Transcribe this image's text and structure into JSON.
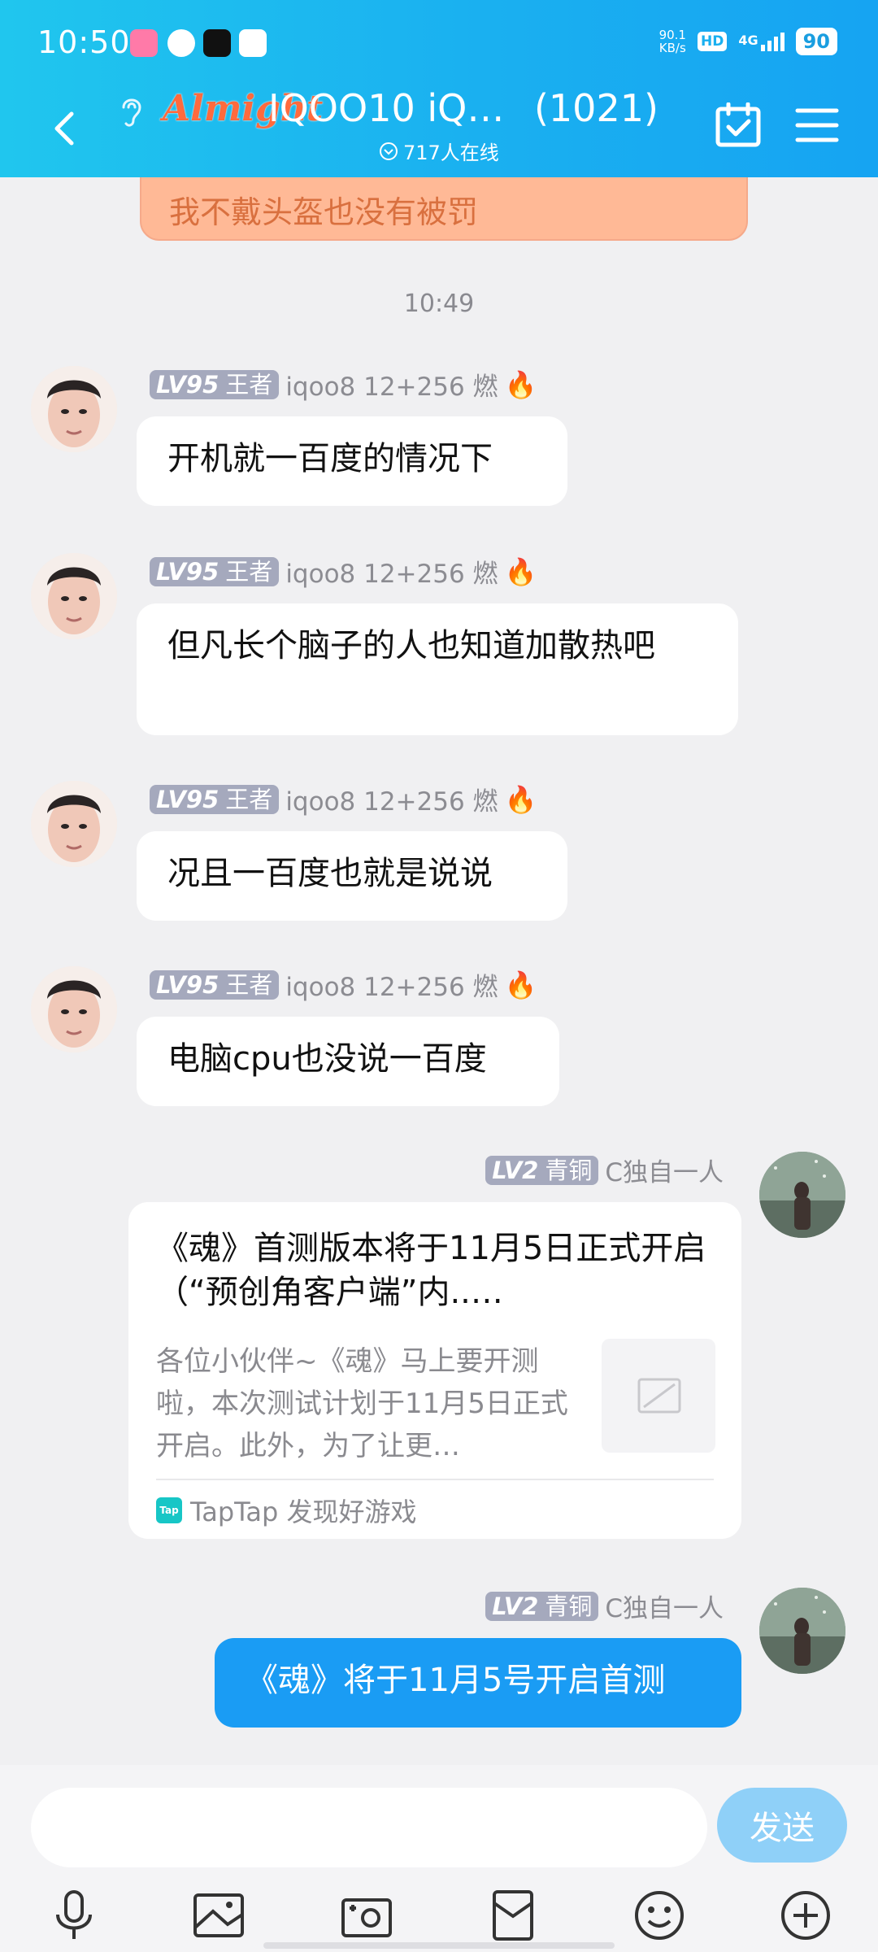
{
  "status_bar": {
    "time": "10:50",
    "net_speed_value": "90.1",
    "net_speed_unit": "KB/s",
    "hd": "HD",
    "signal": "4G",
    "battery": "90"
  },
  "header": {
    "logo_text": "Almight",
    "title": "IQOO10 iQ…",
    "member_count": "(1021)",
    "online_text": "717人在线"
  },
  "chat": {
    "previous_message": "我不戴头盔也没有被罚",
    "timestamp": "10:49",
    "messages": [
      {
        "level": "LV95",
        "rank": "王者",
        "name": "iqoo8 12+256 燃",
        "text": "开机就一百度的情况下"
      },
      {
        "level": "LV95",
        "rank": "王者",
        "name": "iqoo8 12+256 燃",
        "text": "但凡长个脑子的人也知道加散热吧"
      },
      {
        "level": "LV95",
        "rank": "王者",
        "name": "iqoo8 12+256 燃",
        "text": "况且一百度也就是说说"
      },
      {
        "level": "LV95",
        "rank": "王者",
        "name": "iqoo8 12+256 燃",
        "text": "电脑cpu也没说一百度"
      }
    ],
    "share_card": {
      "level": "LV2",
      "rank": "青铜",
      "name": "C独自一人",
      "title": "《魂》首测版本将于11月5日正式开启（“预创角客户端”内..…",
      "description": "各位小伙伴~《魂》马上要开测啦，本次测试计划于11月5日正式开启。此外，为了让更…",
      "source_logo": "Tap",
      "source": "TapTap 发现好游戏"
    },
    "last_message": {
      "level": "LV2",
      "rank": "青铜",
      "name": "C独自一人",
      "text": "《魂》将于11月5号开启首测"
    }
  },
  "input": {
    "placeholder": "",
    "send_label": "发送"
  },
  "colors": {
    "header_start": "#20c6ee",
    "header_end": "#16a4f2",
    "accent_blue": "#1a9cf4",
    "send_button": "#8fd0f8",
    "level_badge": "#a5a9bd",
    "previous_bubble": "#ffb996"
  },
  "icons": [
    "back-icon",
    "ear-icon",
    "calendar-check-icon",
    "menu-icon",
    "microphone-icon",
    "image-icon",
    "camera-icon",
    "red-packet-icon",
    "emoji-icon",
    "plus-icon",
    "fire-icon",
    "image-placeholder-icon"
  ]
}
